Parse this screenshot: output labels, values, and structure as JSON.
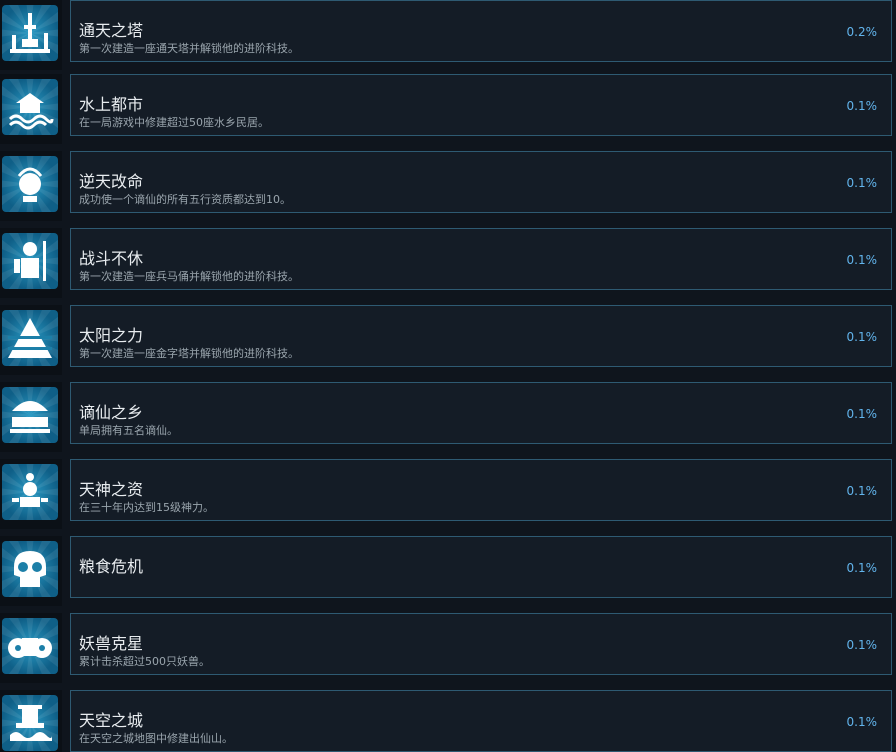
{
  "achievements": [
    {
      "icon": "tower-icon",
      "title": "通天之塔",
      "desc": "第一次建造一座通天塔并解锁他的进阶科技。",
      "pct": "0.2%"
    },
    {
      "icon": "water-city-icon",
      "title": "水上都市",
      "desc": "在一局游戏中修建超过50座水乡民居。",
      "pct": "0.1%"
    },
    {
      "icon": "immortal-head-icon",
      "title": "逆天改命",
      "desc": "成功使一个谪仙的所有五行资质都达到10。",
      "pct": "0.1%"
    },
    {
      "icon": "warrior-icon",
      "title": "战斗不休",
      "desc": "第一次建造一座兵马俑并解锁他的进阶科技。",
      "pct": "0.1%"
    },
    {
      "icon": "pyramid-icon",
      "title": "太阳之力",
      "desc": "第一次建造一座金字塔并解锁他的进阶科技。",
      "pct": "0.1%"
    },
    {
      "icon": "village-icon",
      "title": "谪仙之乡",
      "desc": "单局拥有五名谪仙。",
      "pct": "0.1%"
    },
    {
      "icon": "deity-icon",
      "title": "天神之资",
      "desc": "在三十年内达到15级神力。",
      "pct": "0.1%"
    },
    {
      "icon": "skull-icon",
      "title": "粮食危机",
      "desc": "",
      "pct": "0.1%"
    },
    {
      "icon": "beast-icon",
      "title": "妖兽克星",
      "desc": "累计击杀超过500只妖兽。",
      "pct": "0.1%"
    },
    {
      "icon": "sky-castle-icon",
      "title": "天空之城",
      "desc": "在天空之城地图中修建出仙山。",
      "pct": "0.1%"
    }
  ],
  "colors": {
    "icon_bg_inner": "#2a9ac4",
    "icon_bg_outer": "#0f5f87",
    "percent": "#62b4ec",
    "panel_border": "#2e5a72"
  }
}
